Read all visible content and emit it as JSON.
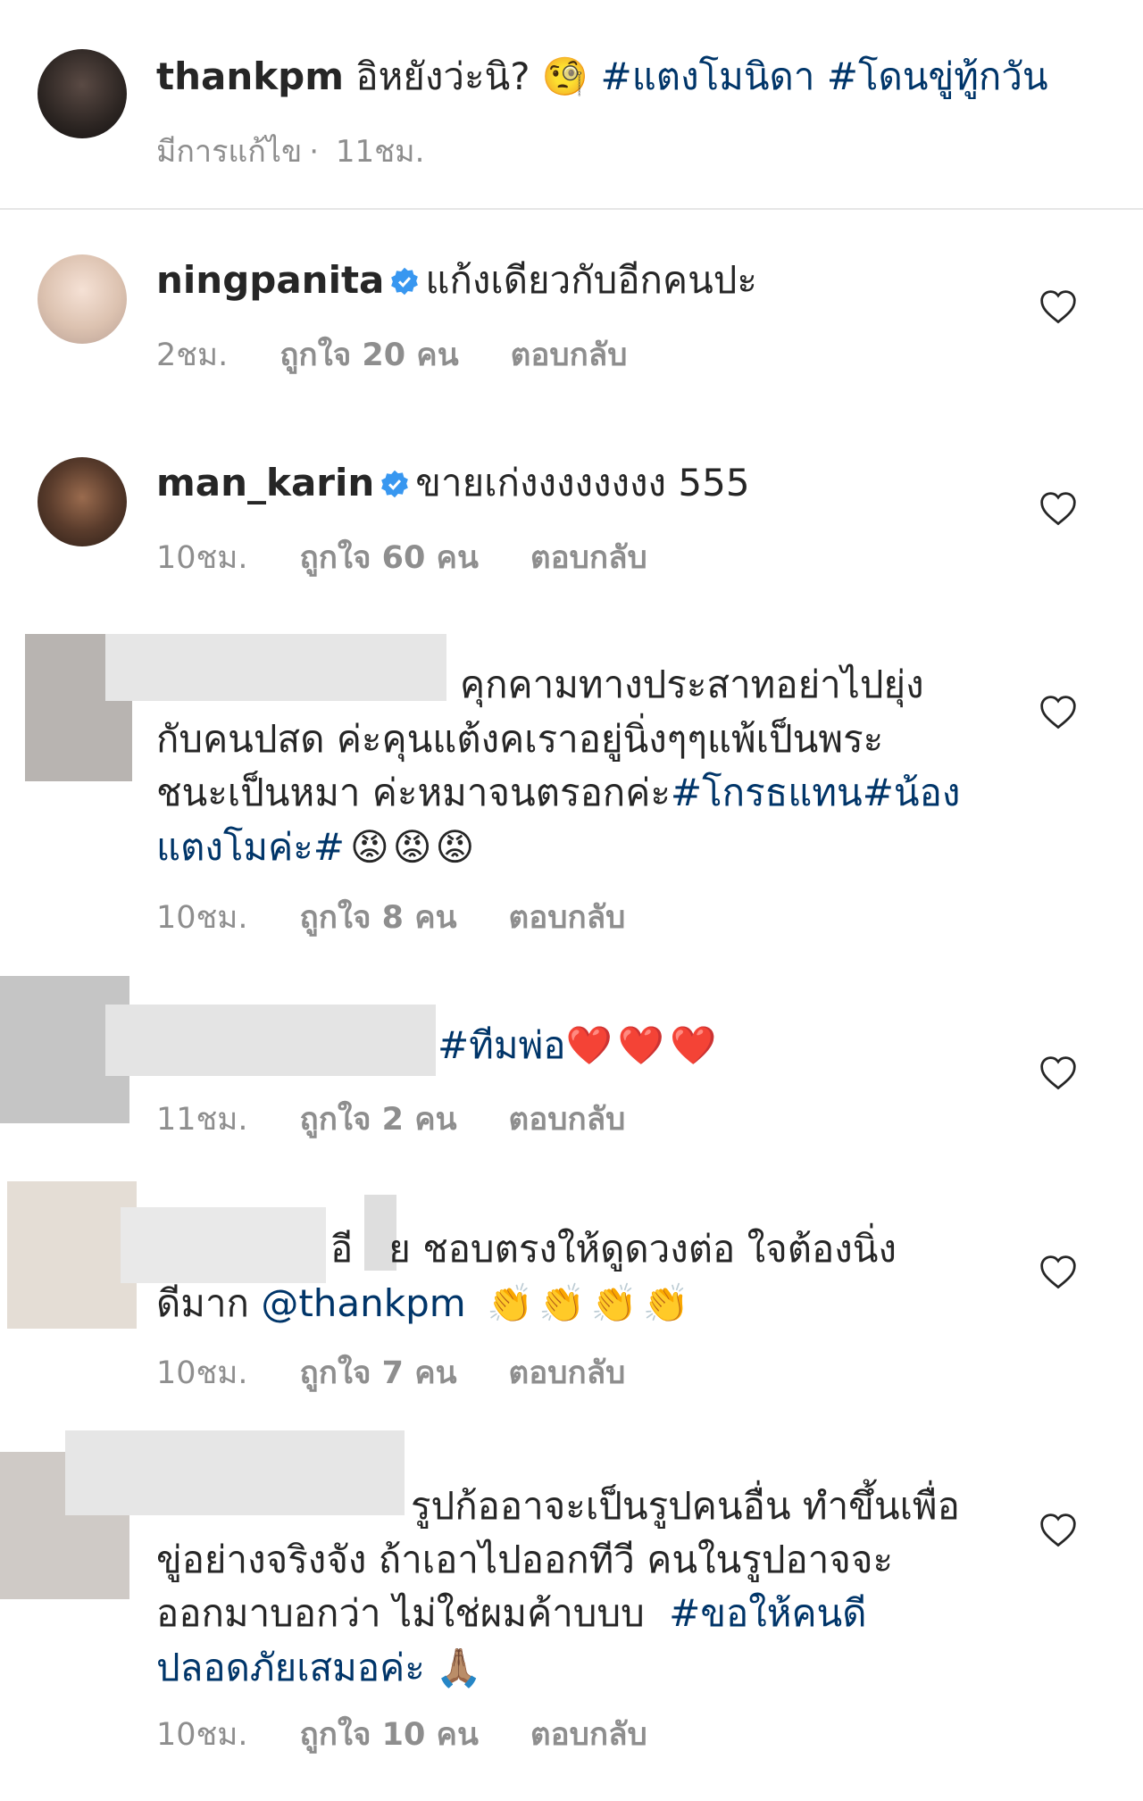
{
  "post": {
    "username": "thankpm",
    "caption": "อิหยังว่ะนิ?",
    "emoji": "🧐",
    "hashtags": "#แตงโมนิดา #โดนขู่ทู้กวัน",
    "edited_label": "มีการแก้ไข",
    "time": "11ชม."
  },
  "comments": [
    {
      "username": "ningpanita",
      "text": "แก้งเดียวกับอีกคนปะ",
      "time": "2ชม.",
      "likes": "ถูกใจ 20 คน",
      "reply": "ตอบกลับ"
    },
    {
      "username": "man_karin",
      "text": "ขายเก่งงงงงงงง 555",
      "time": "10ชม.",
      "likes": "ถูกใจ 60 คน",
      "reply": "ตอบกลับ"
    },
    {
      "line1": "คุกคามทางประสาทอย่าไปยุ่ง",
      "line2": "กับคนปสด ค่ะคุนแต้งคเราอยู่นิ่งๆๆแพ้เป็นพระ",
      "line3a": "ชนะเป็นหมา ค่ะหมาจนตรอกค่ะ",
      "line3tag": "#โกรธแทน#น้อง",
      "line4tag": "แตงโมค่ะ#",
      "emoji": "😡😡😡",
      "time": "10ชม.",
      "likes": "ถูกใจ 8 คน",
      "reply": "ตอบกลับ"
    },
    {
      "tag": "#ทีมพ่อ",
      "emoji": "❤️❤️❤️",
      "time": "11ชม.",
      "likes": "ถูกใจ 2 คน",
      "reply": "ตอบกลับ"
    },
    {
      "line1a": "อี",
      "line1b": "ย ชอบตรงให้ดูดวงต่อ ใจต้องนิ่ง",
      "line2": "ดีมาก",
      "mention": "@thankpm",
      "emoji": "👏👏👏👏",
      "time": "10ชม.",
      "likes": "ถูกใจ 7 คน",
      "reply": "ตอบกลับ"
    },
    {
      "line1": "รูปก้ออาจะเป็นรูปคนอื่น ทำขึ้นเพื่อ",
      "line2": "ขู่อย่างจริงจัง ถ้าเอาไปออกทีวี คนในรูปอาจจะ",
      "line3": "ออกมาบอกว่า ไม่ใช่ผมค้าบบบ",
      "line3tag": "#ขอให้คนดี",
      "line4tag": "ปลอดภัยเสมอค่ะ",
      "emoji": "🙏🏽",
      "time": "10ชม.",
      "likes": "ถูกใจ 10 คน",
      "reply": "ตอบกลับ"
    }
  ],
  "colors": {
    "hashtag": "#003569",
    "meta": "#8e8e8e",
    "verified": "#3897f0"
  },
  "icons": {
    "heart": "heart-outline-icon",
    "verified": "verified-badge-icon"
  }
}
